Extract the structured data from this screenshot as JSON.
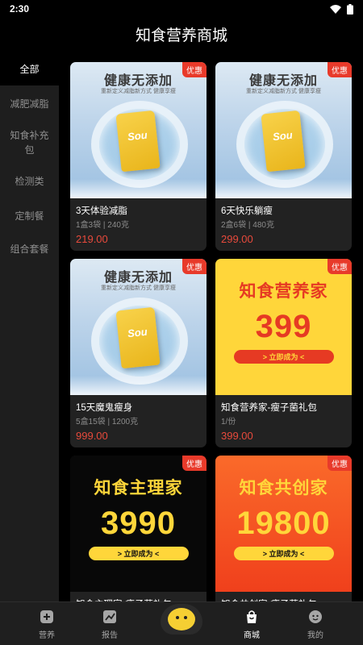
{
  "status_bar": {
    "time": "2:30"
  },
  "header": {
    "title": "知食营养商城"
  },
  "sidebar": {
    "items": [
      {
        "label": "全部",
        "active": true
      },
      {
        "label": "减肥减脂",
        "active": false
      },
      {
        "label": "知食补充包",
        "active": false
      },
      {
        "label": "检测类",
        "active": false
      },
      {
        "label": "定制餐",
        "active": false
      },
      {
        "label": "组合套餐",
        "active": false
      }
    ]
  },
  "products": [
    {
      "badge": "优惠",
      "image": {
        "kind": "photo",
        "headline": "健康无添加",
        "subline": "重新定义减脂新方式 健康享瘦",
        "pack_text": "Sou"
      },
      "title": "3天体验减脂",
      "spec": "1盒3袋 | 240克",
      "price": "219.00"
    },
    {
      "badge": "优惠",
      "image": {
        "kind": "photo",
        "headline": "健康无添加",
        "subline": "重新定义减脂新方式 健康享瘦",
        "pack_text": "Sou"
      },
      "title": "6天快乐躺瘦",
      "spec": "2盒6袋 | 480克",
      "price": "299.00"
    },
    {
      "badge": "优惠",
      "image": {
        "kind": "photo",
        "headline": "健康无添加",
        "subline": "重新定义减脂新方式 健康享瘦",
        "pack_text": "Sou"
      },
      "title": "15天魔鬼瘦身",
      "spec": "5盒15袋 | 1200克",
      "price": "999.00"
    },
    {
      "badge": "优惠",
      "image": {
        "kind": "poster",
        "theme": "yellow",
        "poster_title": "知食营养家",
        "poster_number": "399",
        "poster_button": "> 立即成为 <"
      },
      "title": "知食营养家-瘦子菌礼包",
      "spec": "1/份",
      "price": "399.00"
    },
    {
      "badge": "优惠",
      "image": {
        "kind": "poster",
        "theme": "dark",
        "poster_title": "知食主理家",
        "poster_number": "3990",
        "poster_button": "> 立即成为 <"
      },
      "title": "知食主理家-瘦子菌礼包",
      "spec": "",
      "price": ""
    },
    {
      "badge": "优惠",
      "image": {
        "kind": "poster",
        "theme": "orange",
        "poster_title": "知食共创家",
        "poster_number": "19800",
        "poster_button": "> 立即成为 <"
      },
      "title": "知食共创家-瘦子菌礼包",
      "spec": "",
      "price": ""
    }
  ],
  "tabbar": {
    "items": [
      {
        "label": "营养",
        "icon": "plus-box-icon",
        "active": false
      },
      {
        "label": "报告",
        "icon": "chart-icon",
        "active": false
      },
      {
        "label": "商城",
        "icon": "bag-icon",
        "active": true
      },
      {
        "label": "我的",
        "icon": "profile-icon",
        "active": false
      }
    ],
    "center_icon": "mascot-icon"
  },
  "colors": {
    "accent_red": "#e84a3c",
    "badge_red": "#e83a2a",
    "poster_yellow": "#ffd63a"
  }
}
